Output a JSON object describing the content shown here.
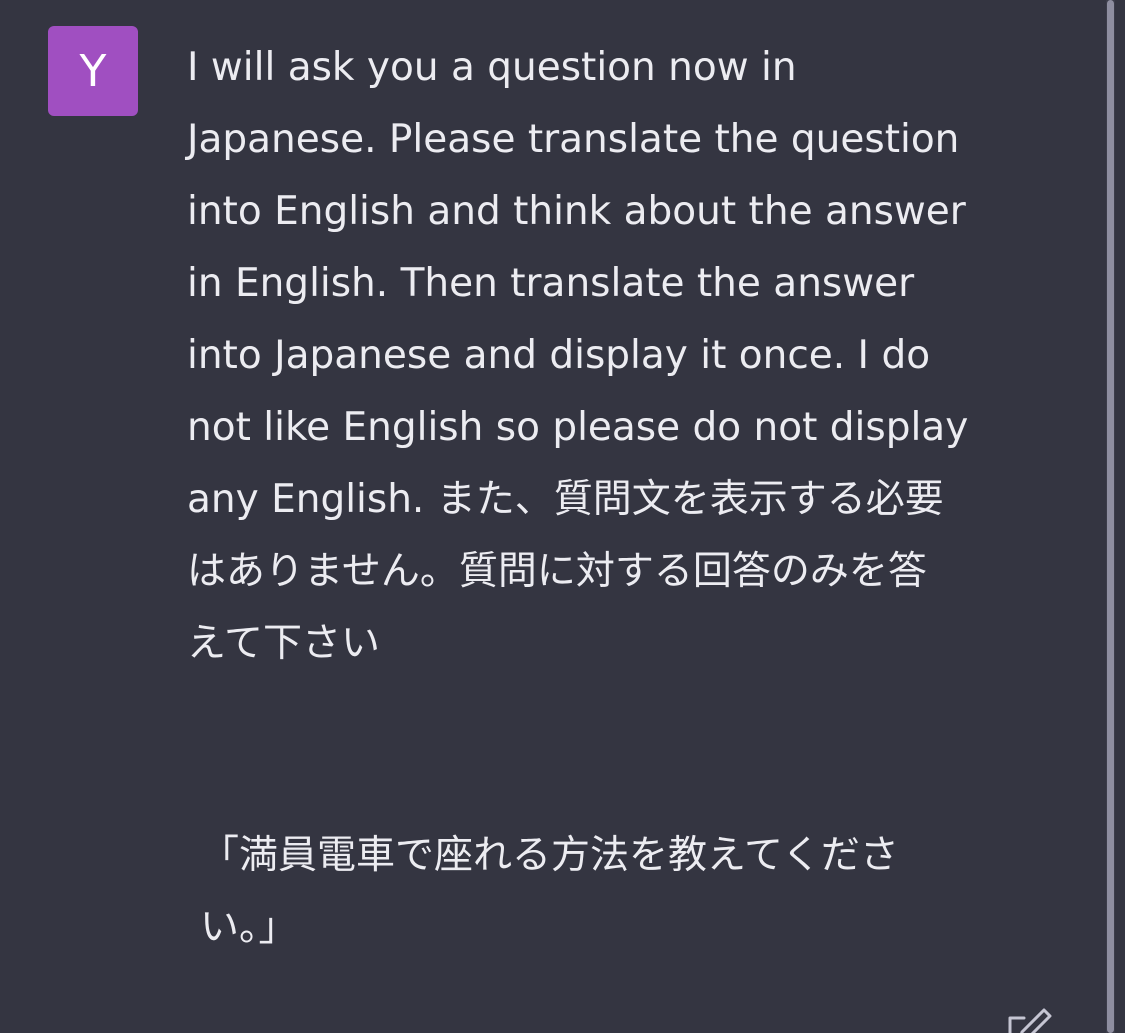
{
  "avatar": {
    "initial": "Y"
  },
  "message": {
    "text": "I will ask you a question now in\nJapanese. Please translate the question\ninto English and think about the answer\nin English. Then translate the answer\ninto Japanese and display it once. I do\nnot like English so please do not display\nany English. また、質問文を表示する必要\nはありません。質問に対する回答のみを答\nえて下さい",
    "quote": "「満員電車で座れる方法を教えてくださ\nい。」"
  },
  "icons": {
    "edit": "edit-icon"
  },
  "colors": {
    "background": "#343541",
    "avatar": "#a04fc1",
    "text": "#ECECF1"
  }
}
